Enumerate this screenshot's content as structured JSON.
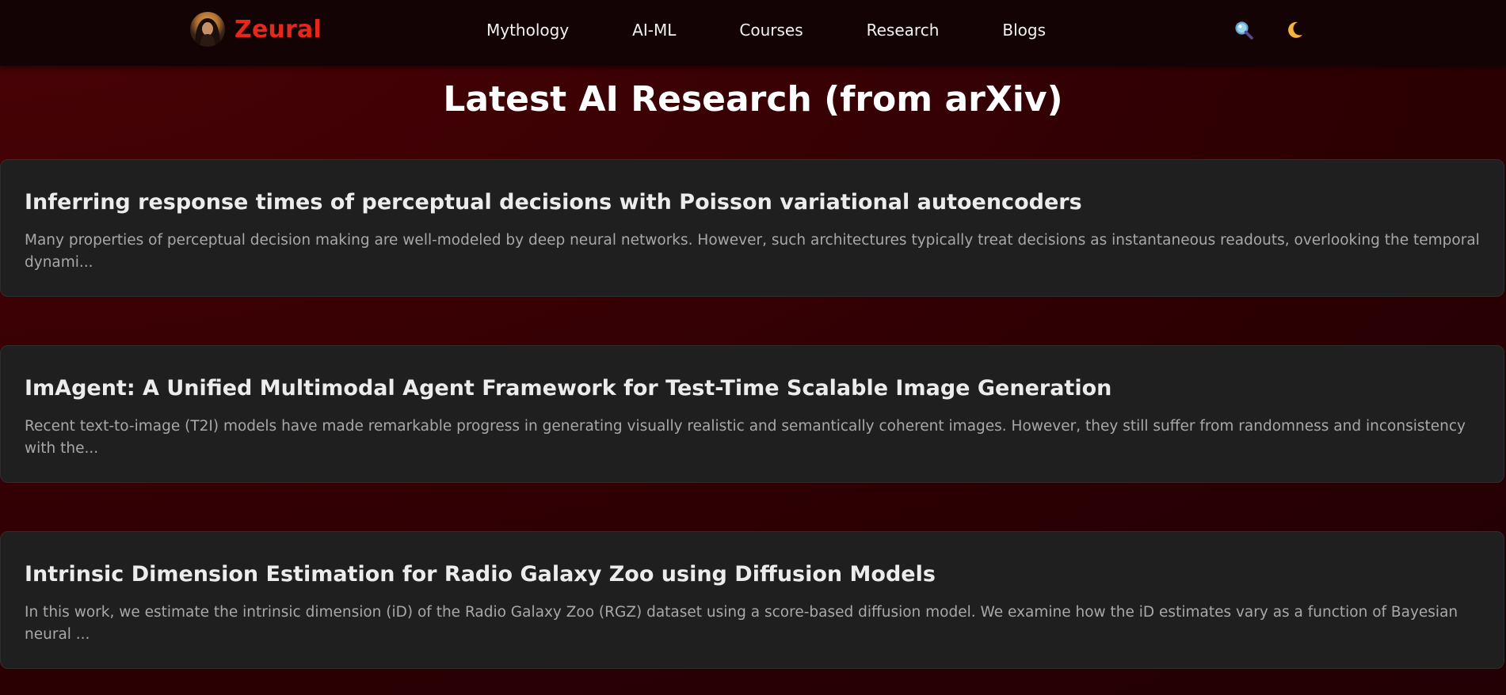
{
  "brand": {
    "name": "Zeural"
  },
  "nav": {
    "links": [
      {
        "label": "Mythology"
      },
      {
        "label": "AI-ML"
      },
      {
        "label": "Courses"
      },
      {
        "label": "Research"
      },
      {
        "label": "Blogs"
      }
    ],
    "icons": [
      "search-icon",
      "moon-icon"
    ]
  },
  "page": {
    "title": "Latest AI Research (from arXiv)"
  },
  "papers": [
    {
      "title": "Inferring response times of perceptual decisions with Poisson variational autoencoders",
      "summary": "Many properties of perceptual decision making are well-modeled by deep neural networks. However, such architectures typically treat decisions as instantaneous readouts, overlooking the temporal dynami..."
    },
    {
      "title": "ImAgent: A Unified Multimodal Agent Framework for Test-Time Scalable Image Generation",
      "summary": "Recent text-to-image (T2I) models have made remarkable progress in generating visually realistic and semantically coherent images. However, they still suffer from randomness and inconsistency with the..."
    },
    {
      "title": "Intrinsic Dimension Estimation for Radio Galaxy Zoo using Diffusion Models",
      "summary": "In this work, we estimate the intrinsic dimension (iD) of the Radio Galaxy Zoo (RGZ) dataset using a score-based diffusion model. We examine how the iD estimates vary as a function of Bayesian neural ..."
    }
  ],
  "colors": {
    "brand": "#e8271c",
    "navbar": "#130304",
    "card": "#1f1f1f",
    "background": "#3a0104"
  }
}
